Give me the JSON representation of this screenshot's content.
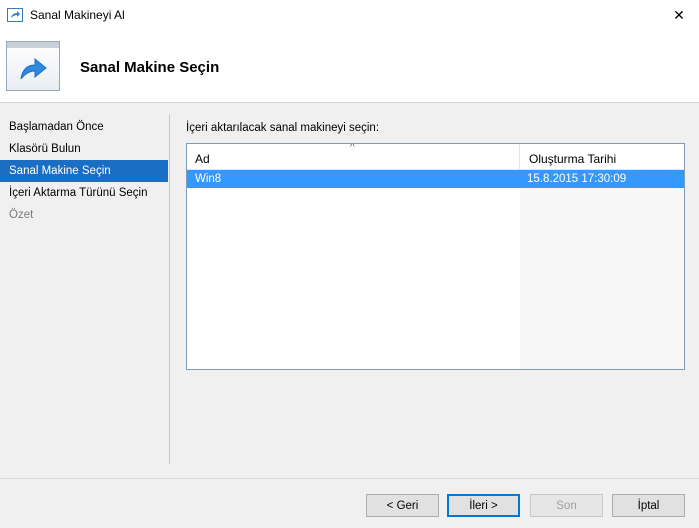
{
  "window": {
    "title": "Sanal Makineyi Al",
    "close_glyph": "✕"
  },
  "header": {
    "title": "Sanal Makine Seçin",
    "icon": "import-arrow-icon"
  },
  "nav": {
    "items": [
      {
        "label": "Başlamadan Önce",
        "state": "normal"
      },
      {
        "label": "Klasörü Bulun",
        "state": "normal"
      },
      {
        "label": "Sanal Makine Seçin",
        "state": "active"
      },
      {
        "label": "İçeri Aktarma Türünü Seçin",
        "state": "normal"
      },
      {
        "label": "Özet",
        "state": "disabled"
      }
    ]
  },
  "main": {
    "instruction": "İçeri aktarılacak sanal makineyi seçin:",
    "list": {
      "columns": [
        "Ad",
        "Oluşturma Tarihi"
      ],
      "rows": [
        {
          "name": "Win8",
          "created": "15.8.2015 17:30:09",
          "selected": true
        }
      ]
    }
  },
  "buttons": {
    "back": "< Geri",
    "next": "İleri >",
    "finish": "Son",
    "cancel": "İptal"
  },
  "colors": {
    "accent": "#1a6fc4",
    "selection": "#3399ff"
  }
}
